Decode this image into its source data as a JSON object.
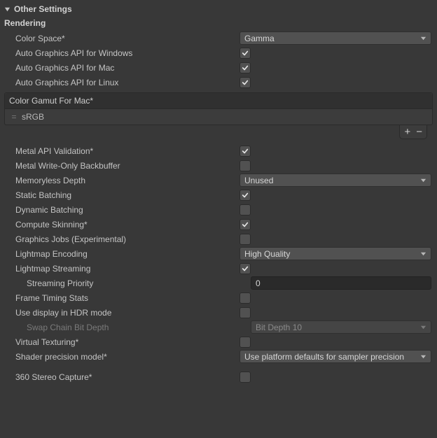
{
  "header": {
    "title": "Other Settings"
  },
  "section": {
    "rendering": "Rendering"
  },
  "labels": {
    "color_space": "Color Space*",
    "auto_api_win": "Auto Graphics API for Windows",
    "auto_api_mac": "Auto Graphics API for Mac",
    "auto_api_linux": "Auto Graphics API for Linux",
    "gamut_header": "Color Gamut For Mac*",
    "gamut_item0": "sRGB",
    "metal_api_validation": "Metal API Validation*",
    "metal_write_only": "Metal Write-Only Backbuffer",
    "memoryless_depth": "Memoryless Depth",
    "static_batching": "Static Batching",
    "dynamic_batching": "Dynamic Batching",
    "compute_skinning": "Compute Skinning*",
    "graphics_jobs": "Graphics Jobs (Experimental)",
    "lightmap_encoding": "Lightmap Encoding",
    "lightmap_streaming": "Lightmap Streaming",
    "streaming_priority": "Streaming Priority",
    "frame_timing": "Frame Timing Stats",
    "hdr_mode": "Use display in HDR mode",
    "swap_chain": "Swap Chain Bit Depth",
    "virtual_texturing": "Virtual Texturing*",
    "shader_precision": "Shader precision model*",
    "stereo_capture": "360 Stereo Capture*"
  },
  "values": {
    "color_space": "Gamma",
    "memoryless_depth": "Unused",
    "lightmap_encoding": "High Quality",
    "streaming_priority": "0",
    "swap_chain": "Bit Depth 10",
    "shader_precision": "Use platform defaults for sampler precision"
  },
  "icons": {
    "plus": "+",
    "minus": "−"
  }
}
